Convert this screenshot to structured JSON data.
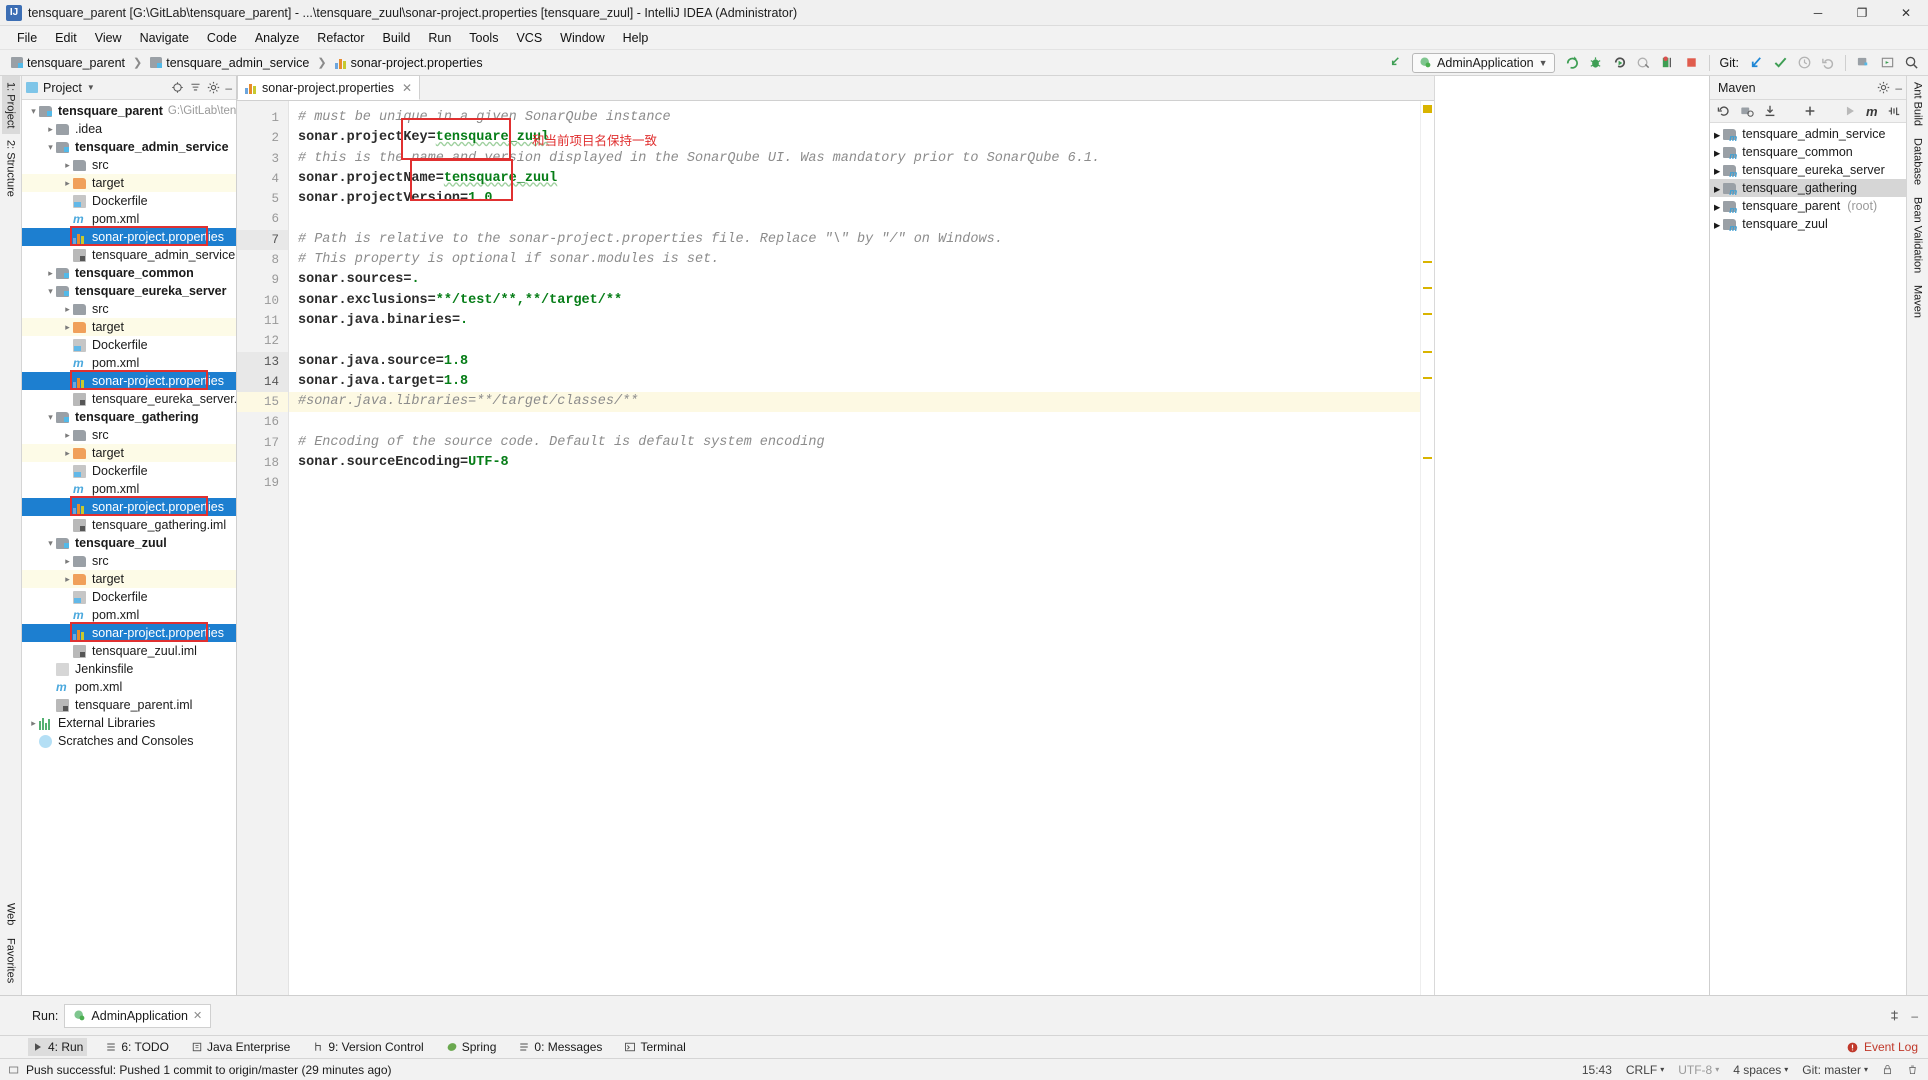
{
  "window": {
    "title": "tensquare_parent [G:\\GitLab\\tensquare_parent] - ...\\tensquare_zuul\\sonar-project.properties [tensquare_zuul] - IntelliJ IDEA (Administrator)",
    "app_icon_letter": "IJ",
    "minimize": "─",
    "maximize": "❐",
    "close": "✕"
  },
  "menu": [
    "File",
    "Edit",
    "View",
    "Navigate",
    "Code",
    "Analyze",
    "Refactor",
    "Build",
    "Run",
    "Tools",
    "VCS",
    "Window",
    "Help"
  ],
  "breadcrumb": [
    {
      "label": "tensquare_parent",
      "icon": "module-icon"
    },
    {
      "label": "tensquare_admin_service",
      "icon": "module-icon"
    },
    {
      "label": "sonar-project.properties",
      "icon": "sonar-icon"
    }
  ],
  "toolbar": {
    "run_config": "AdminApplication",
    "git_label": "Git:",
    "icons": [
      "back-arrow-icon",
      "run-icon",
      "debug-icon",
      "run-with-coverage-icon",
      "profile-icon",
      "stop-icon",
      "update-project-icon",
      "commit-icon",
      "history-icon",
      "rollback-icon",
      "settings-icon",
      "preview-icon",
      "search-icon"
    ]
  },
  "left_rail": {
    "top": [
      "1: Project",
      "2: Structure"
    ],
    "bottom": [
      "Web",
      "Favorites"
    ]
  },
  "right_rail": [
    "Ant Build",
    "Database",
    "Bean Validation",
    "Maven"
  ],
  "project_panel": {
    "title": "Project",
    "tree": [
      {
        "depth": 0,
        "arrow": "down",
        "icon": "module-icon",
        "label": "tensquare_parent",
        "bold": true,
        "suffix": "G:\\GitLab\\tensquare_"
      },
      {
        "depth": 1,
        "arrow": "right",
        "icon": "folder-icon",
        "label": ".idea"
      },
      {
        "depth": 1,
        "arrow": "down",
        "icon": "module-icon",
        "label": "tensquare_admin_service",
        "bold": true
      },
      {
        "depth": 2,
        "arrow": "right",
        "icon": "folder-icon",
        "label": "src"
      },
      {
        "depth": 2,
        "arrow": "right",
        "icon": "folder-orange-icon",
        "label": "target",
        "highlight": true
      },
      {
        "depth": 2,
        "arrow": "none",
        "icon": "docker-icon",
        "label": "Dockerfile"
      },
      {
        "depth": 2,
        "arrow": "none",
        "icon": "maven-icon",
        "label": "pom.xml"
      },
      {
        "depth": 2,
        "arrow": "none",
        "icon": "sonar-icon",
        "label": "sonar-project.properties",
        "selected": true,
        "boxed": true
      },
      {
        "depth": 2,
        "arrow": "none",
        "icon": "iml-icon",
        "label": "tensquare_admin_service.iml"
      },
      {
        "depth": 1,
        "arrow": "right",
        "icon": "module-icon",
        "label": "tensquare_common",
        "bold": true
      },
      {
        "depth": 1,
        "arrow": "down",
        "icon": "module-icon",
        "label": "tensquare_eureka_server",
        "bold": true
      },
      {
        "depth": 2,
        "arrow": "right",
        "icon": "folder-icon",
        "label": "src"
      },
      {
        "depth": 2,
        "arrow": "right",
        "icon": "folder-orange-icon",
        "label": "target",
        "highlight": true
      },
      {
        "depth": 2,
        "arrow": "none",
        "icon": "docker-icon",
        "label": "Dockerfile"
      },
      {
        "depth": 2,
        "arrow": "none",
        "icon": "maven-icon",
        "label": "pom.xml"
      },
      {
        "depth": 2,
        "arrow": "none",
        "icon": "sonar-icon",
        "label": "sonar-project.properties",
        "selected": true,
        "boxed": true
      },
      {
        "depth": 2,
        "arrow": "none",
        "icon": "iml-icon",
        "label": "tensquare_eureka_server.iml"
      },
      {
        "depth": 1,
        "arrow": "down",
        "icon": "module-icon",
        "label": "tensquare_gathering",
        "bold": true
      },
      {
        "depth": 2,
        "arrow": "right",
        "icon": "folder-icon",
        "label": "src"
      },
      {
        "depth": 2,
        "arrow": "right",
        "icon": "folder-orange-icon",
        "label": "target",
        "highlight": true
      },
      {
        "depth": 2,
        "arrow": "none",
        "icon": "docker-icon",
        "label": "Dockerfile"
      },
      {
        "depth": 2,
        "arrow": "none",
        "icon": "maven-icon",
        "label": "pom.xml"
      },
      {
        "depth": 2,
        "arrow": "none",
        "icon": "sonar-icon",
        "label": "sonar-project.properties",
        "selected": true,
        "boxed": true
      },
      {
        "depth": 2,
        "arrow": "none",
        "icon": "iml-icon",
        "label": "tensquare_gathering.iml"
      },
      {
        "depth": 1,
        "arrow": "down",
        "icon": "module-icon",
        "label": "tensquare_zuul",
        "bold": true
      },
      {
        "depth": 2,
        "arrow": "right",
        "icon": "folder-icon",
        "label": "src"
      },
      {
        "depth": 2,
        "arrow": "right",
        "icon": "folder-orange-icon",
        "label": "target",
        "highlight": true
      },
      {
        "depth": 2,
        "arrow": "none",
        "icon": "docker-icon",
        "label": "Dockerfile"
      },
      {
        "depth": 2,
        "arrow": "none",
        "icon": "maven-icon",
        "label": "pom.xml"
      },
      {
        "depth": 2,
        "arrow": "none",
        "icon": "sonar-icon",
        "label": "sonar-project.properties",
        "selected": true,
        "boxed": true
      },
      {
        "depth": 2,
        "arrow": "none",
        "icon": "iml-icon",
        "label": "tensquare_zuul.iml"
      },
      {
        "depth": 1,
        "arrow": "none",
        "icon": "jenkins-icon",
        "label": "Jenkinsfile"
      },
      {
        "depth": 1,
        "arrow": "none",
        "icon": "maven-icon",
        "label": "pom.xml"
      },
      {
        "depth": 1,
        "arrow": "none",
        "icon": "iml-icon",
        "label": "tensquare_parent.iml"
      },
      {
        "depth": 0,
        "arrow": "right",
        "icon": "libraries-icon",
        "label": "External Libraries"
      },
      {
        "depth": 0,
        "arrow": "none",
        "icon": "scratches-icon",
        "label": "Scratches and Consoles"
      }
    ]
  },
  "editor": {
    "tab": {
      "label": "sonar-project.properties",
      "icon": "sonar-icon",
      "close": "✕"
    },
    "current_line": 15,
    "lines": [
      {
        "n": 1,
        "type": "comment",
        "text": "# must be unique in a given SonarQube instance"
      },
      {
        "n": 2,
        "type": "kv",
        "key": "sonar.projectKey",
        "value": "tensquare_zuul",
        "boxed": true,
        "squiggle": true
      },
      {
        "n": 3,
        "type": "comment",
        "text": "# this is the name and version displayed in the SonarQube UI. Was mandatory prior to SonarQube 6.1."
      },
      {
        "n": 4,
        "type": "kv",
        "key": "sonar.projectName",
        "value": "tensquare_zuul",
        "boxed": true,
        "squiggle": true
      },
      {
        "n": 5,
        "type": "kv",
        "key": "sonar.projectVersion",
        "value": "1.0"
      },
      {
        "n": 6,
        "type": "blank",
        "text": ""
      },
      {
        "n": 7,
        "type": "comment",
        "text": "# Path is relative to the sonar-project.properties file. Replace \"\\\" by \"/\" on Windows."
      },
      {
        "n": 8,
        "type": "comment",
        "text": "# This property is optional if sonar.modules is set."
      },
      {
        "n": 9,
        "type": "kv",
        "key": "sonar.sources",
        "value": "."
      },
      {
        "n": 10,
        "type": "kv",
        "key": "sonar.exclusions",
        "value": "**/test/**,**/target/**"
      },
      {
        "n": 11,
        "type": "kv",
        "key": "sonar.java.binaries",
        "value": "."
      },
      {
        "n": 12,
        "type": "blank",
        "text": ""
      },
      {
        "n": 13,
        "type": "kv",
        "key": "sonar.java.source",
        "value": "1.8"
      },
      {
        "n": 14,
        "type": "kv",
        "key": "sonar.java.target",
        "value": "1.8"
      },
      {
        "n": 15,
        "type": "comment",
        "text": "#sonar.java.libraries=**/target/classes/**",
        "highlighted": true
      },
      {
        "n": 16,
        "type": "blank",
        "text": ""
      },
      {
        "n": 17,
        "type": "comment",
        "text": "# Encoding of the source code. Default is default system encoding"
      },
      {
        "n": 18,
        "type": "kv",
        "key": "sonar.sourceEncoding",
        "value": "UTF-8"
      },
      {
        "n": 19,
        "type": "blank",
        "text": ""
      }
    ],
    "annotation": "和当前项目名保持一致"
  },
  "maven_panel": {
    "title": "Maven",
    "items": [
      {
        "label": "tensquare_admin_service"
      },
      {
        "label": "tensquare_common"
      },
      {
        "label": "tensquare_eureka_server"
      },
      {
        "label": "tensquare_gathering",
        "selected": true
      },
      {
        "label": "tensquare_parent",
        "suffix": "(root)"
      },
      {
        "label": "tensquare_zuul"
      }
    ],
    "toolbar_icons": [
      "reimport-icon",
      "generate-sources-icon",
      "download-sources-icon",
      "add-icon",
      "run-icon",
      "maven-goal-icon",
      "toggle-skip-icon",
      "more-icon"
    ]
  },
  "run_panel": {
    "label": "Run:",
    "tab": "AdminApplication",
    "tab_close": "✕"
  },
  "tool_windows": [
    {
      "label": "4: Run",
      "icon": "run-icon",
      "active": true
    },
    {
      "label": "6: TODO",
      "icon": "todo-icon"
    },
    {
      "label": "Java Enterprise",
      "icon": "java-ee-icon"
    },
    {
      "label": "9: Version Control",
      "icon": "vcs-icon"
    },
    {
      "label": "Spring",
      "icon": "spring-icon"
    },
    {
      "label": "0: Messages",
      "icon": "messages-icon"
    },
    {
      "label": "Terminal",
      "icon": "terminal-icon"
    }
  ],
  "event_log": "Event Log",
  "status_bar": {
    "message": "Push successful: Pushed 1 commit to origin/master (29 minutes ago)",
    "time": "15:43",
    "line_sep": "CRLF",
    "encoding": "UTF-8",
    "indent": "4 spaces",
    "branch": "Git: master"
  },
  "colors": {
    "selection_blue": "#1d7fd0",
    "annotation_red": "#e03030",
    "value_green": "#067d17",
    "highlight_yellow": "#fdf9e3"
  }
}
